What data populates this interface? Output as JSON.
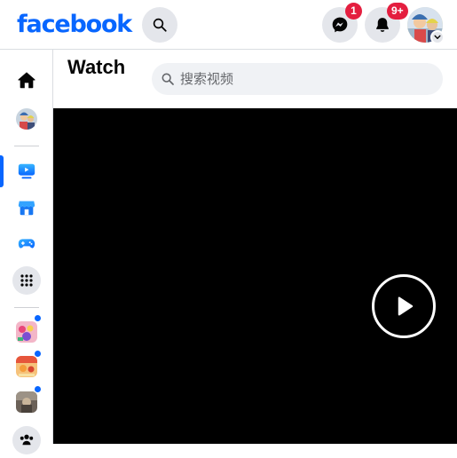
{
  "brand": {
    "logo_text": "facebook",
    "accent_color": "#0866ff",
    "badge_color": "#e41e3f"
  },
  "header": {
    "search_icon": "search-icon",
    "messenger": {
      "icon": "messenger-icon",
      "badge": "1"
    },
    "notifications": {
      "icon": "bell-icon",
      "badge": "9+"
    },
    "account": {
      "icon": "chevron-down-icon"
    }
  },
  "sidebar": {
    "items": [
      {
        "name": "home",
        "icon": "home-icon",
        "active": false
      },
      {
        "name": "profile",
        "icon": "avatar",
        "active": false
      },
      {
        "name": "watch",
        "icon": "watch-icon",
        "active": true
      },
      {
        "name": "marketplace",
        "icon": "marketplace-icon",
        "active": false
      },
      {
        "name": "gaming",
        "icon": "gaming-icon",
        "active": false
      },
      {
        "name": "menu",
        "icon": "grid-icon",
        "active": false
      }
    ],
    "groups": [
      {
        "name": "group-1",
        "unread": true
      },
      {
        "name": "group-2",
        "unread": true
      },
      {
        "name": "group-3",
        "unread": true
      }
    ],
    "more_icon": "people-icon"
  },
  "watch": {
    "title": "Watch",
    "search_placeholder": "搜索视频"
  },
  "player": {
    "play_icon": "play-icon",
    "background": "#000000"
  }
}
